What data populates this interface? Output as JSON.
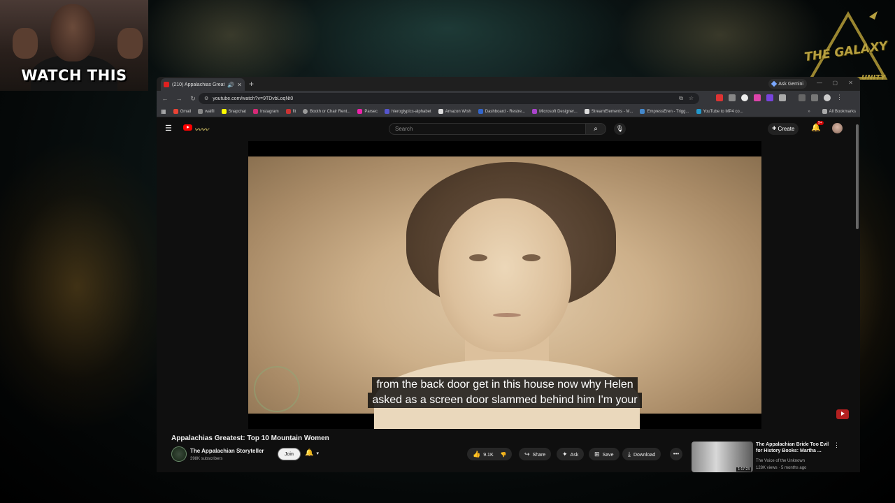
{
  "overlay": {
    "cam_text": "WATCH THIS",
    "logo_text": "THE GALAXY",
    "logo_sub": "UNITY"
  },
  "browser": {
    "tab_title": "(210) Appalachias Greatest",
    "url": "youtube.com/watch?v=9TDvbLoqNt0",
    "gemini_label": "Ask Gemini",
    "bookmarks": [
      "Gmail",
      "waifil",
      "Snapchat",
      "Instagram",
      "fit",
      "Booth or Chair Rent...",
      "Parsec",
      "hieroglypics-alphabet",
      "Amazon Wish",
      "Dashboard - Restre...",
      "Microsoft Designer...",
      "StreamElements - M...",
      "EmpressEren - Trigg...",
      "YouTube to MP4 co..."
    ],
    "all_bookmarks": "All Bookmarks"
  },
  "youtube": {
    "search_placeholder": "Search",
    "create_label": "Create",
    "notif_badge": "9+",
    "subtitle_line1": "from the back door get in this house now why Helen",
    "subtitle_line2": "asked as a screen door slammed behind him I'm your",
    "video_title": "Appalachias Greatest: Top 10 Mountain Women",
    "channel_name": "The Appalachian Storyteller",
    "channel_subs": "398K subscribers",
    "join_label": "Join",
    "likes": "9.1K",
    "share_label": "Share",
    "ask_label": "Ask",
    "save_label": "Save",
    "download_label": "Download",
    "rec": {
      "title": "The Appalachian Bride Too Evil for History Books: Martha ...",
      "channel": "The Voice of the Unknown",
      "meta": "128K views · 5 months ago",
      "duration": "1:17:23"
    }
  },
  "colors": {
    "accent_red": "#ff0000",
    "page_bg": "#0f0f0f"
  }
}
